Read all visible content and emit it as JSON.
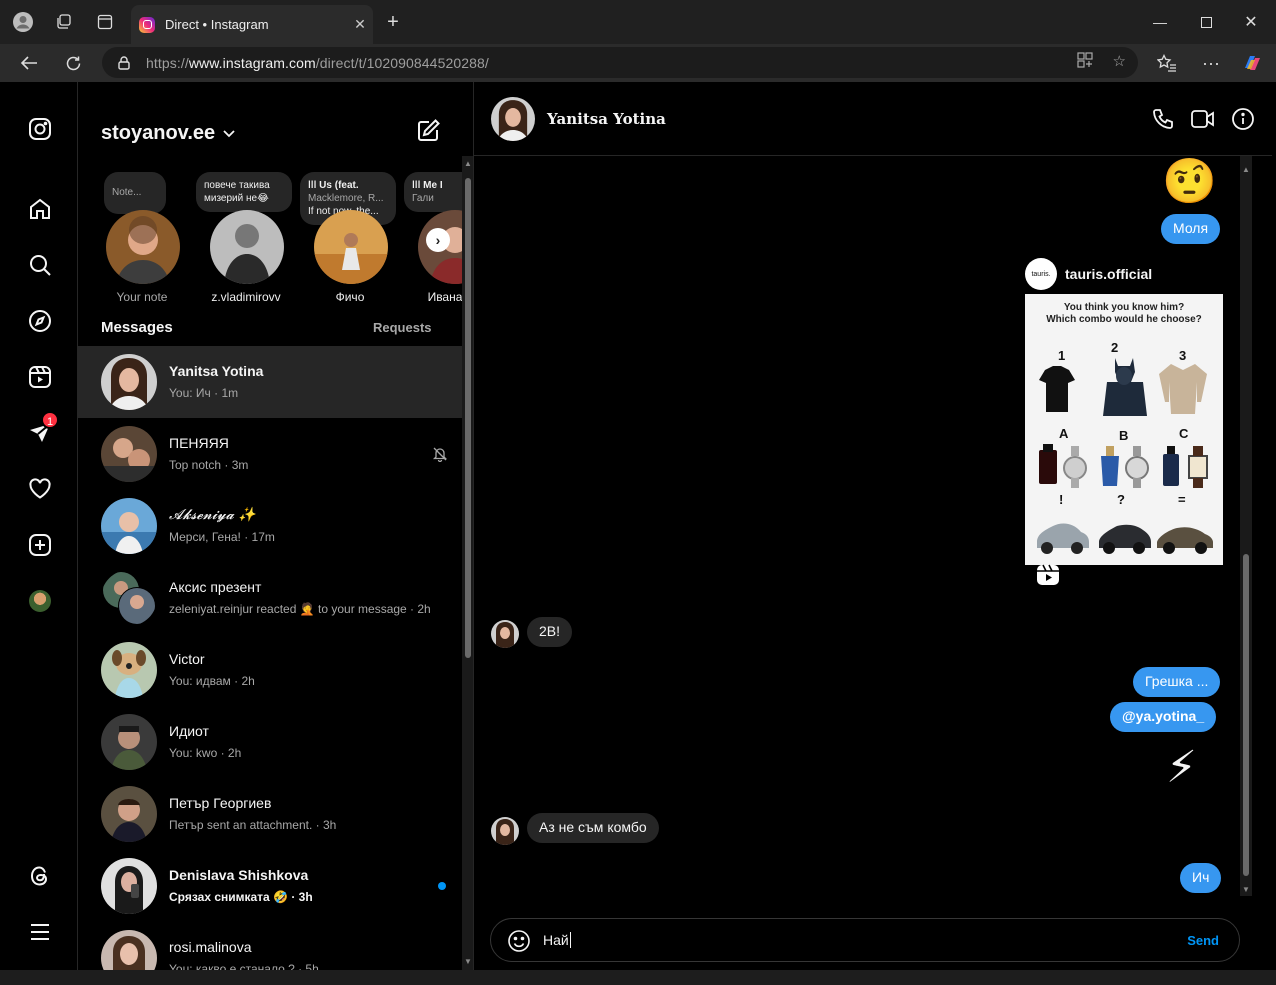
{
  "browser": {
    "tab_title": "Direct • Instagram",
    "url_scheme": "https://",
    "url_host": "www.instagram.com",
    "url_path": "/direct/t/102090844520288/"
  },
  "rail": {
    "notification_badge": "1"
  },
  "inbox": {
    "username": "stoyanov.ee",
    "messages_label": "Messages",
    "requests_label": "Requests",
    "notes": [
      {
        "bubble": "Note...",
        "sub": "",
        "name": "Your note"
      },
      {
        "bubble": "повече такива",
        "sub": "мизерий не😂",
        "name": "z.vladimirovv"
      },
      {
        "bubble": "ǀǀǀ Us (feat.",
        "sub": "Macklemore, R...",
        "sub2": "If not now, the...",
        "name": "Фичо"
      },
      {
        "bubble": "ǀǀǀ Me I",
        "sub": "Гали",
        "name": "Ивана Ва"
      }
    ],
    "threads": [
      {
        "name": "Yanitsa Yotina",
        "sub": "You: Ич · 1m"
      },
      {
        "name": "ПЕНЯЯЯ",
        "sub": "Top notch · 3m"
      },
      {
        "name": "𝓐𝓴𝓼𝓮𝓷𝓲𝔂𝓪 ✨",
        "sub": "Мерси, Гена! · 17m"
      },
      {
        "name": "Аксис презент",
        "sub": "zeleniyat.reinjur reacted 🤦 to your message · 2h"
      },
      {
        "name": "Victor",
        "sub": "You: идвам · 2h"
      },
      {
        "name": "Идиот",
        "sub": "You: kwo · 2h"
      },
      {
        "name": "Петър Георгиев",
        "sub": "Петър sent an attachment. · 3h"
      },
      {
        "name": "Denislava Shishkova",
        "sub": "Срязах снимката 🤣 · 3h"
      },
      {
        "name": "rosi.malinova",
        "sub": "You: какво е станало ? · 5h"
      }
    ]
  },
  "conversation": {
    "contact_name": "Yanitsa Yotina",
    "emoji_1": "🤨",
    "msg_molya": "Моля",
    "share": {
      "logo_text": "tauris.",
      "username": "tauris.official",
      "question_line1": "You think you know him?",
      "question_line2": "Which combo would he choose?",
      "labels": [
        "1",
        "2",
        "3",
        "A",
        "B",
        "C",
        "!",
        "?",
        "="
      ]
    },
    "msg_2b": "2B!",
    "msg_greshka": "Грешка ...",
    "msg_mention": "@ya.yotina_",
    "emoji_2": "⚡",
    "msg_kombo": "Аз не съм комбо",
    "msg_ich": "Ич",
    "composer_text": "Най",
    "send_label": "Send"
  },
  "colors": {
    "accent": "#3797f0",
    "send": "#0095f6",
    "badge": "#ff3040",
    "incoming": "#262626"
  }
}
